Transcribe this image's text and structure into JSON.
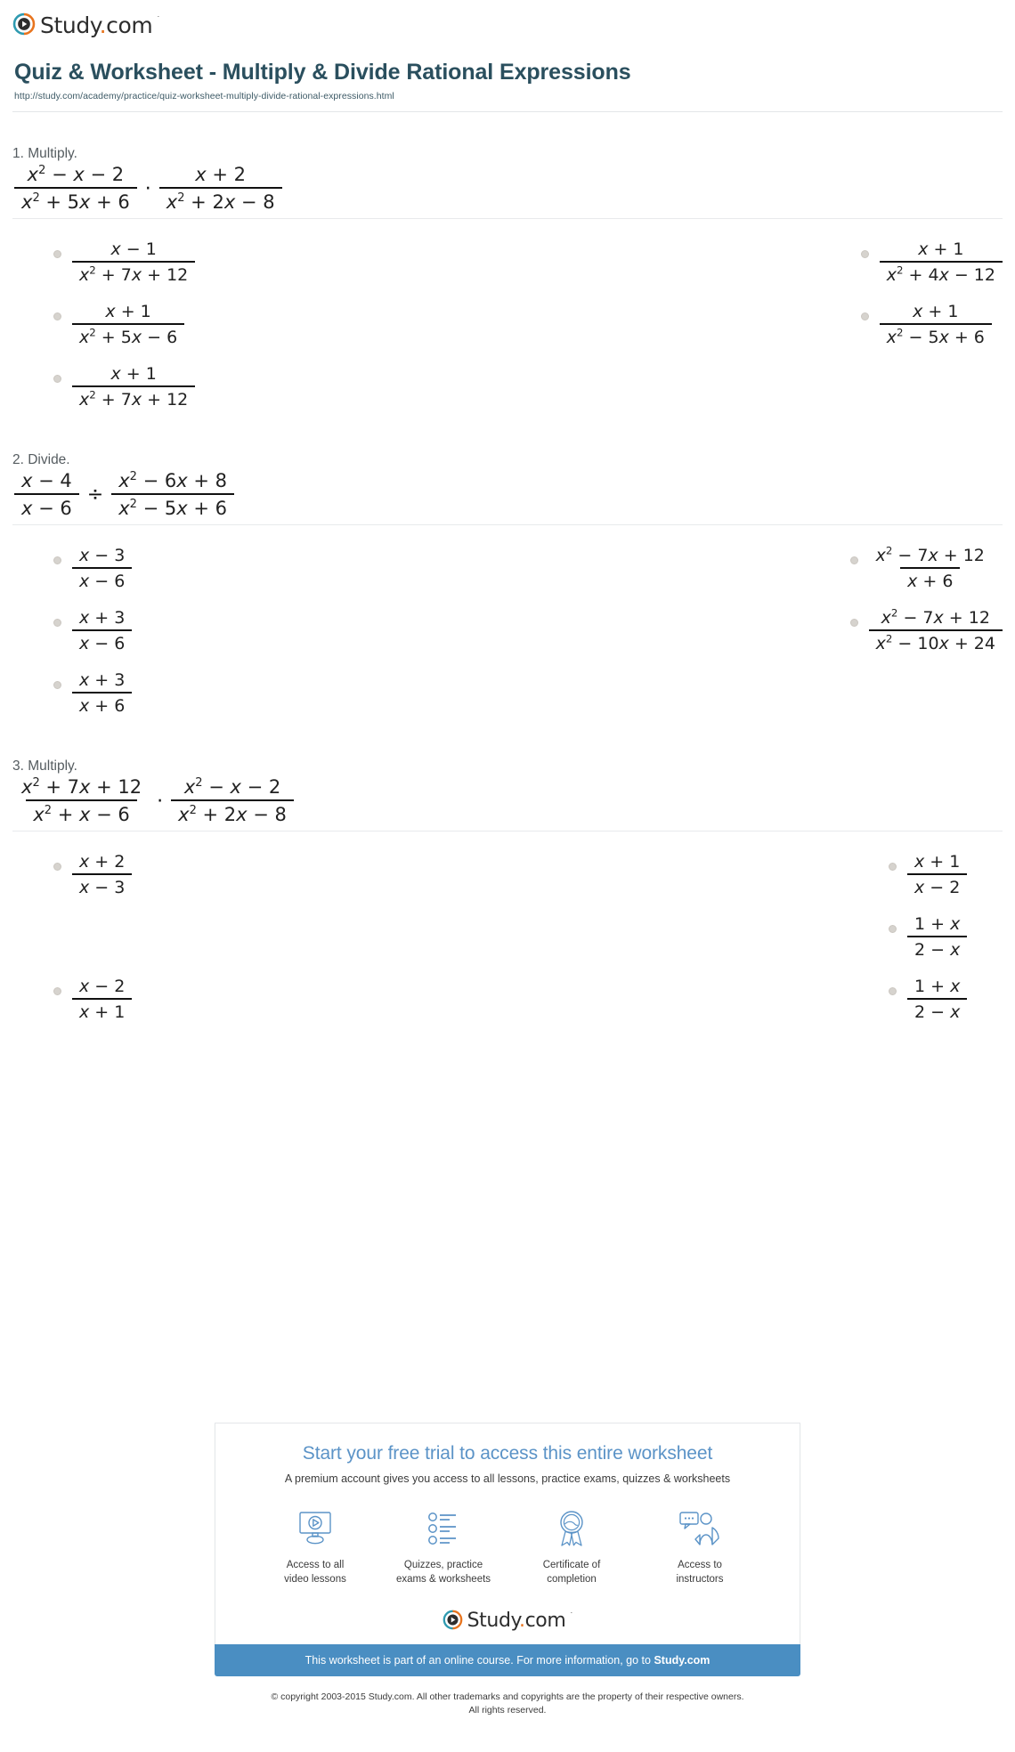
{
  "brand": {
    "name_main": "Study",
    "name_dot": ".",
    "name_tld": "com",
    "trademark": "·",
    "logo_icon": "play-circle-icon"
  },
  "header": {
    "title": "Quiz & Worksheet - Multiply & Divide Rational Expressions",
    "url": "http://study.com/academy/practice/quiz-worksheet-multiply-divide-rational-expressions.html"
  },
  "questions": [
    {
      "prompt": "1. Multiply.",
      "expression": {
        "operator": "·",
        "left": {
          "num": "x² − x − 2",
          "den": "x² + 5x + 6"
        },
        "right": {
          "num": "x + 2",
          "den": "x² + 2x − 8"
        }
      },
      "options": [
        {
          "column": "left",
          "num": "x − 1",
          "den": "x² + 7x + 12"
        },
        {
          "column": "right",
          "num": "x + 1",
          "den": "x² + 4x − 12"
        },
        {
          "column": "left",
          "num": "x + 1",
          "den": "x² + 5x − 6"
        },
        {
          "column": "right",
          "num": "x + 1",
          "den": "x² − 5x + 6"
        },
        {
          "column": "left",
          "num": "x + 1",
          "den": "x² + 7x + 12"
        }
      ]
    },
    {
      "prompt": "2. Divide.",
      "expression": {
        "operator": "÷",
        "left": {
          "num": "x − 4",
          "den": "x − 6"
        },
        "right": {
          "num": "x² − 6x + 8",
          "den": "x² − 5x + 6"
        }
      },
      "options": [
        {
          "column": "left",
          "num": "x − 3",
          "den": "x − 6"
        },
        {
          "column": "right",
          "num": "x² − 7x + 12",
          "den": "x + 6"
        },
        {
          "column": "left",
          "num": "x + 3",
          "den": "x − 6"
        },
        {
          "column": "right",
          "num": "x² − 7x + 12",
          "den": "x² − 10x + 24"
        },
        {
          "column": "left",
          "num": "x + 3",
          "den": "x + 6"
        }
      ]
    },
    {
      "prompt": "3. Multiply.",
      "expression": {
        "operator": "·",
        "left": {
          "num": "x² + 7x + 12",
          "den": "x² + x − 6"
        },
        "right": {
          "num": "x² − x − 2",
          "den": "x² + 2x − 8"
        }
      },
      "options": [
        {
          "column": "left",
          "num": "x + 2",
          "den": "x − 3"
        },
        {
          "column": "right",
          "num": "x + 1",
          "den": "x − 2"
        },
        {
          "column": "left",
          "num": "",
          "den": ""
        },
        {
          "column": "right",
          "num": "1 + x",
          "den": "2 − x"
        },
        {
          "column": "left",
          "num": "x − 2",
          "den": "x + 1"
        },
        {
          "column": "right",
          "num": "1 + x",
          "den": "2 − x"
        }
      ]
    }
  ],
  "promo": {
    "title": "Start your free trial to access this entire worksheet",
    "subtitle": "A premium account gives you access to all lessons, practice exams, quizzes & worksheets",
    "features": [
      {
        "icon": "video-lesson-icon",
        "label": "Access to all\nvideo lessons"
      },
      {
        "icon": "checklist-icon",
        "label": "Quizzes, practice\nexams & worksheets"
      },
      {
        "icon": "certificate-ribbon-icon",
        "label": "Certificate of\ncompletion"
      },
      {
        "icon": "instructor-chat-icon",
        "label": "Access to\ninstructors"
      }
    ],
    "bar_text_prefix": "This worksheet is part of an online course. For more information, go to ",
    "bar_text_link": "Study.com"
  },
  "footer": {
    "copyright_line1": "© copyright 2003-2015 Study.com. All other trademarks and copyrights are the property of their respective owners.",
    "copyright_line2": "All rights reserved."
  },
  "colors": {
    "title": "#2a4f5e",
    "promo_title": "#5b93c7",
    "promo_bar": "#4a8ec2",
    "brand_orange": "#e8741e",
    "brand_teal": "#2e9ab0"
  }
}
